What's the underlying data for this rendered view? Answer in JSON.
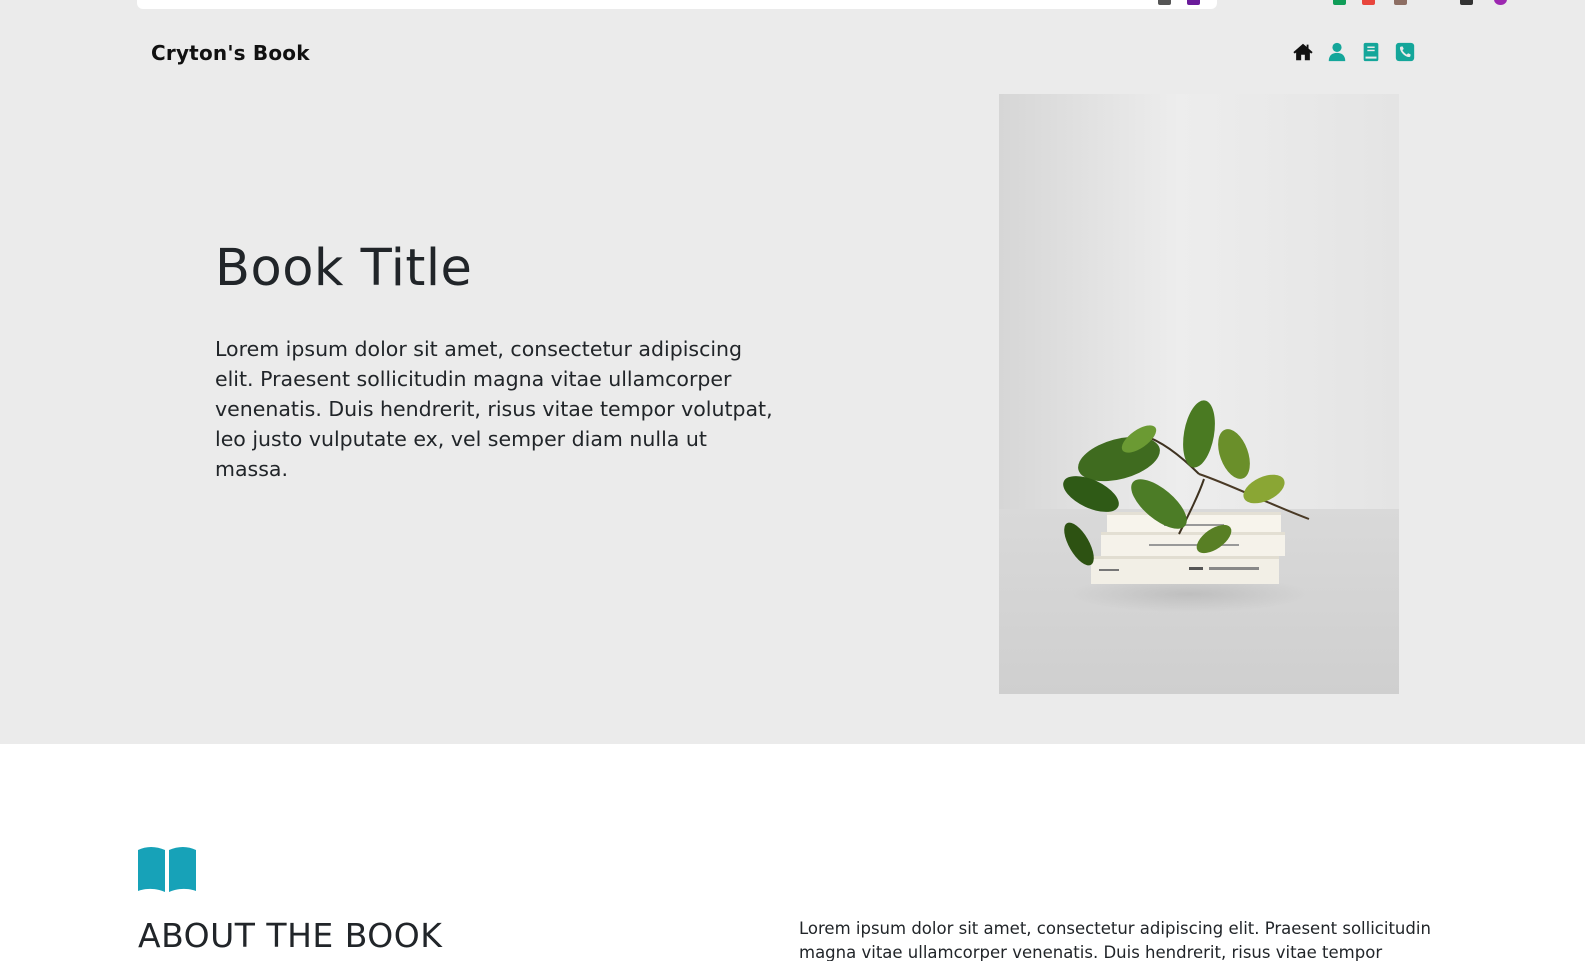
{
  "browser": {
    "url_partial": "...(partially visible address bar)..."
  },
  "header": {
    "brand": "Cryton's Book",
    "nav_icons": [
      "home-icon",
      "user-icon",
      "book-icon",
      "phone-icon"
    ]
  },
  "hero": {
    "title": "Book Title",
    "text": "Lorem ipsum dolor sit amet, consectetur adipiscing elit. Praesent sollicitudin magna vitae ullamcorper venenatis. Duis hendrerit, risus vitae tempor volutpat, leo justo vulputate ex, vel semper diam nulla ut massa.",
    "image_alt": "Stack of books with a green plant sprig"
  },
  "about": {
    "icon": "open-book-icon",
    "title": "ABOUT THE BOOK",
    "text": "Lorem ipsum dolor sit amet, consectetur adipiscing elit. Praesent sollicitudin magna vitae ullamcorper venenatis. Duis hendrerit, risus vitae tempor volutpat,"
  },
  "colors": {
    "hero_bg": "#ebebeb",
    "accent": "#14a69a",
    "about_icon": "#17a2b8",
    "text": "#212529"
  }
}
